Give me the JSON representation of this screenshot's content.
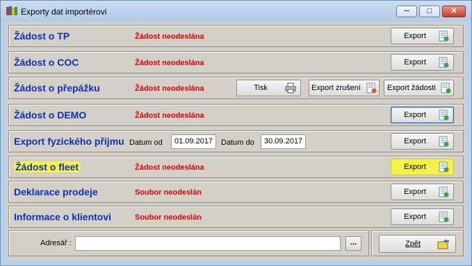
{
  "window": {
    "title": "Exporty dat importérovi"
  },
  "rows": [
    {
      "label": "Žádost o TP",
      "status": "Žádost neodeslána",
      "button": "Export"
    },
    {
      "label": "Žádost o COC",
      "status": "Žádost neodeslána",
      "button": "Export"
    },
    {
      "label": "Žádost o přepážku",
      "status": "Žádost neodeslána",
      "print_button": "Tisk",
      "cancel_button": "Export zrušení",
      "request_button": "Export žádosti"
    },
    {
      "label": "Žádost o DEMO",
      "status": "Žádost neodeslána",
      "button": "Export"
    },
    {
      "label": "Export fyzického příjmu",
      "date_from_label": "Datum od",
      "date_from": "01.09.2017",
      "date_to_label": "Datum do",
      "date_to": "30.09.2017",
      "button": "Export"
    },
    {
      "label": "Žádost o fleet",
      "status": "Žádost neodeslána",
      "button": "Export"
    },
    {
      "label": "Deklarace prodeje",
      "status": "Soubor neodeslán",
      "button": "Export"
    },
    {
      "label": "Informace o klientovi",
      "status": "Soubor neodeslán",
      "button": "Export"
    }
  ],
  "footer": {
    "address_label": "Adresář :",
    "address_value": "",
    "browse_label": "...",
    "back_label": "Zpět"
  },
  "colors": {
    "label_blue": "#0d2fb8",
    "status_red": "#e00000",
    "highlight_yellow": "#f3f347"
  }
}
